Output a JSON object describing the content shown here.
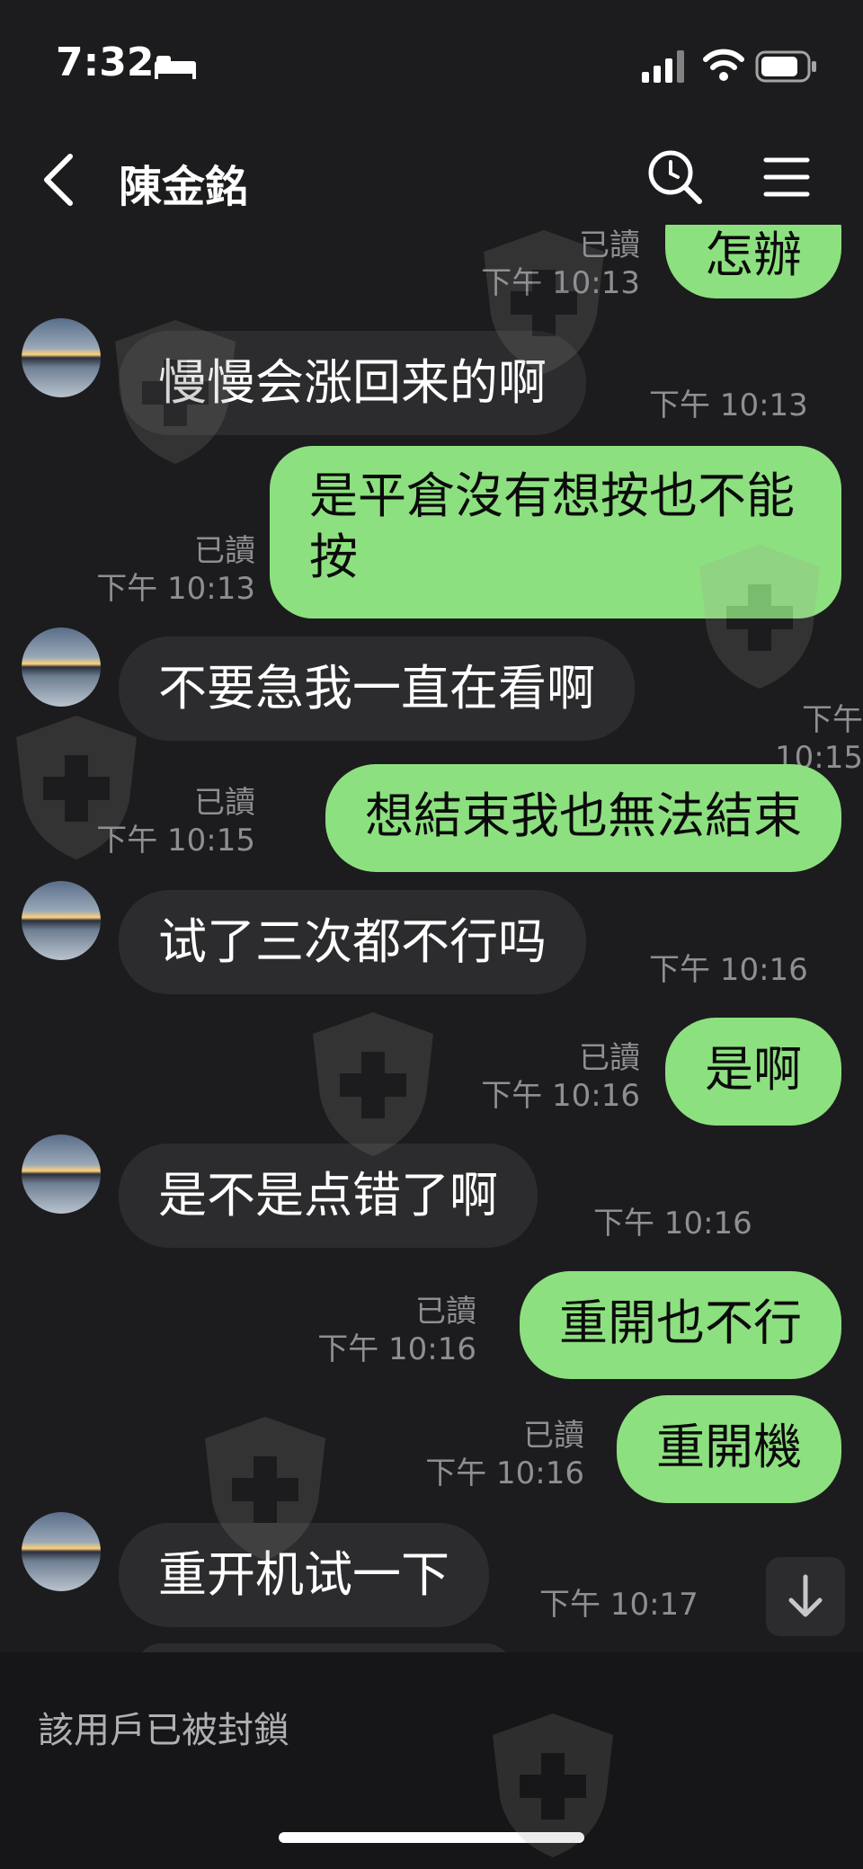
{
  "status_bar": {
    "time": "7:32"
  },
  "header": {
    "contact_name": "陳金銘"
  },
  "messages": [
    {
      "dir": "out",
      "text": "怎辦",
      "read": "已讀",
      "time": "下午 10:13"
    },
    {
      "dir": "in",
      "text": "慢慢会涨回来的啊",
      "time": "下午 10:13"
    },
    {
      "dir": "out",
      "text": "是平倉沒有想按也不能按",
      "read": "已讀",
      "time": "下午 10:13"
    },
    {
      "dir": "in",
      "text": "不要急我一直在看啊",
      "time": "下午 10:15"
    },
    {
      "dir": "out",
      "text": "想結束我也無法結束",
      "read": "已讀",
      "time": "下午 10:15"
    },
    {
      "dir": "in",
      "text": "试了三次都不行吗",
      "time": "下午 10:16"
    },
    {
      "dir": "out",
      "text": "是啊",
      "read": "已讀",
      "time": "下午 10:16"
    },
    {
      "dir": "in",
      "text": "是不是点错了啊",
      "time": "下午 10:16"
    },
    {
      "dir": "out",
      "text": "重開也不行",
      "read": "已讀",
      "time": "下午 10:16"
    },
    {
      "dir": "out",
      "text": "重開機",
      "read": "已讀",
      "time": "下午 10:16"
    },
    {
      "dir": "in",
      "text": "重开机试一下",
      "time": "下午 10:17"
    }
  ],
  "footer": {
    "blocked_text": "該用戶已被封鎖"
  },
  "icons": {
    "back": "back-icon",
    "search": "search-icon",
    "menu": "menu-icon",
    "scroll_down": "arrow-down-icon",
    "watermark": "shield-cross-icon"
  },
  "colors": {
    "background": "#1c1c1e",
    "incoming_bubble": "#2c2c2e",
    "outgoing_bubble": "#8de07f",
    "meta_text": "#8e8e93"
  }
}
